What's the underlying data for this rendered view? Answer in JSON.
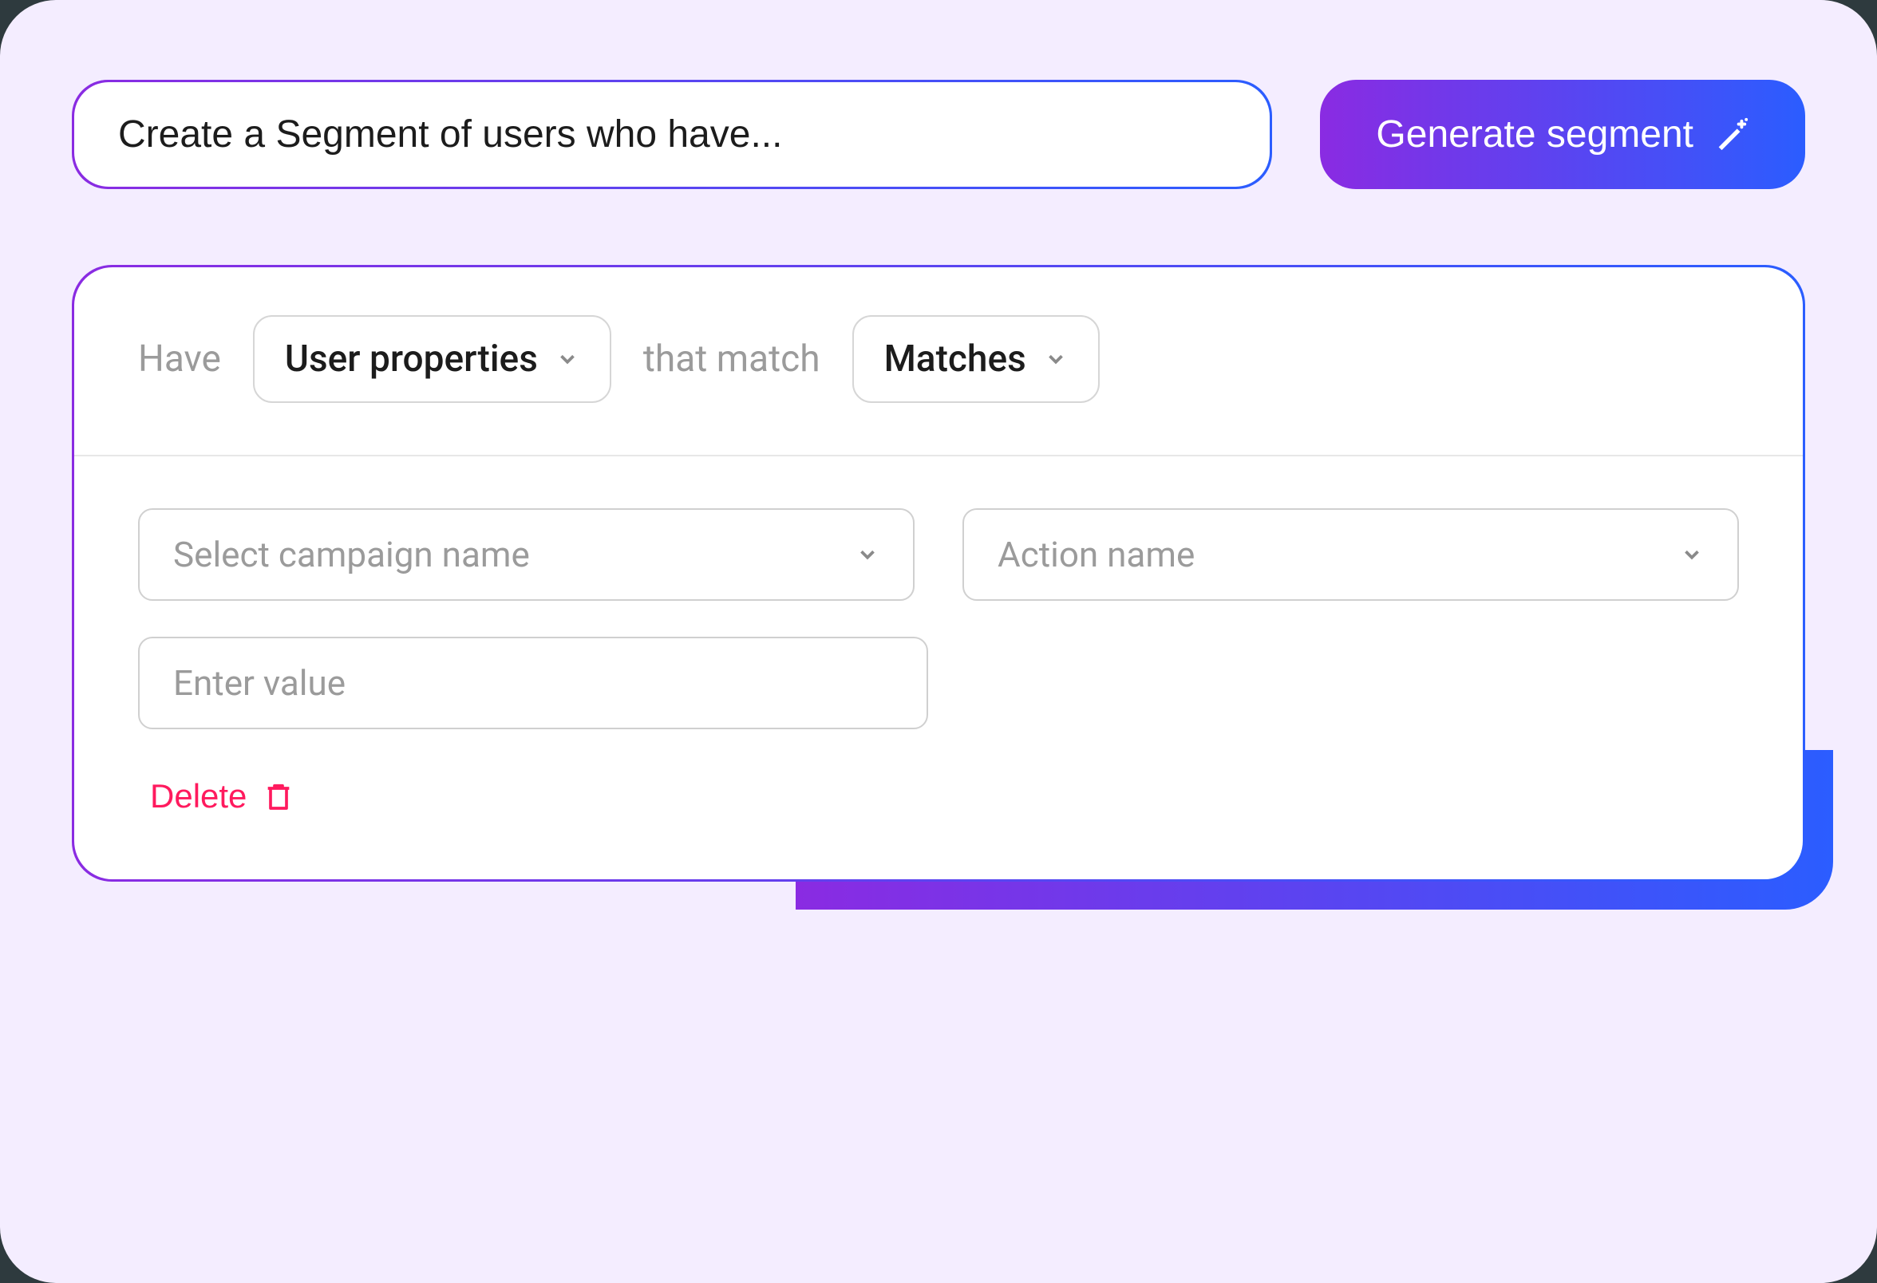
{
  "top": {
    "prompt_text": "Create a Segment of users who have...",
    "generate_label": "Generate segment"
  },
  "builder": {
    "have_label": "Have",
    "type_selected": "User properties",
    "match_label": "that match",
    "operator_selected": "Matches",
    "campaign_placeholder": "Select campaign name",
    "action_placeholder": "Action name",
    "value_placeholder": "Enter value",
    "delete_label": "Delete"
  }
}
